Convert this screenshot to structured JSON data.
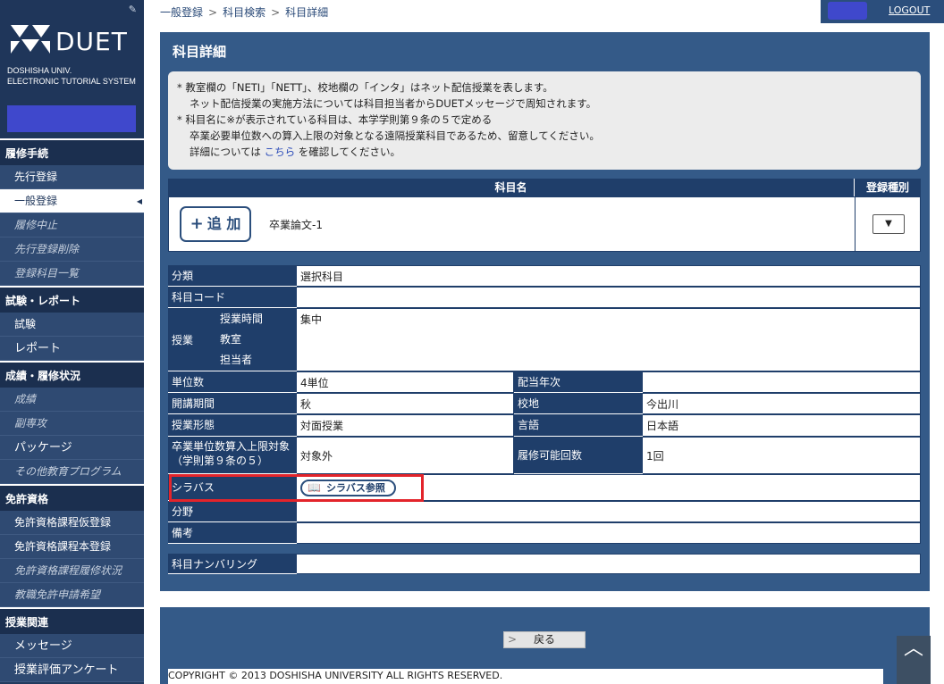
{
  "app": {
    "logo_text": "DUET",
    "logo_sub1": "DOSHISHA UNIV.",
    "logo_sub2": "ELECTRONIC TUTORIAL SYSTEM"
  },
  "sidebar": {
    "sections": [
      {
        "title": "履修手続",
        "items": [
          {
            "label": "先行登録",
            "style": "normal"
          },
          {
            "label": "一般登録",
            "style": "active"
          },
          {
            "label": "履修中止",
            "style": "italic"
          },
          {
            "label": "先行登録削除",
            "style": "italic"
          },
          {
            "label": "登録科目一覧",
            "style": "italic"
          }
        ]
      },
      {
        "title": "試験・レポート",
        "items": [
          {
            "label": "試験",
            "style": "normal"
          },
          {
            "label": "レポート",
            "style": "big"
          }
        ]
      },
      {
        "title": "成績・履修状況",
        "items": [
          {
            "label": "成績",
            "style": "italic"
          },
          {
            "label": "副専攻",
            "style": "italic"
          },
          {
            "label": "パッケージ",
            "style": "big"
          },
          {
            "label": "その他教育プログラム",
            "style": "italic"
          }
        ]
      },
      {
        "title": "免許資格",
        "items": [
          {
            "label": "免許資格課程仮登録",
            "style": "normal"
          },
          {
            "label": "免許資格課程本登録",
            "style": "normal"
          },
          {
            "label": "免許資格課程履修状況",
            "style": "italic"
          },
          {
            "label": "教職免許申請希望",
            "style": "italic"
          }
        ]
      },
      {
        "title": "授業関連",
        "items": [
          {
            "label": "メッセージ",
            "style": "big"
          },
          {
            "label": "授業評価アンケート",
            "style": "big"
          }
        ]
      }
    ]
  },
  "breadcrumb": [
    "一般登録",
    "科目検索",
    "科目詳細"
  ],
  "header": {
    "logout": "LOGOUT"
  },
  "panel": {
    "title": "科目詳細",
    "notice": {
      "line1": "* 教室欄の「NETI」「NETT」、校地欄の「インタ」はネット配信授業を表します。",
      "line2": "ネット配信授業の実施方法については科目担当者からDUETメッセージで周知されます。",
      "line3": "* 科目名に※が表示されている科目は、本学学則第９条の５で定める",
      "line4": "卒業必要単位数への算入上限の対象となる遠隔授業科目であるため、留意してください。",
      "line5_pre": "詳細については",
      "line5_link": "こちら",
      "line5_post": "を確認してください。"
    },
    "course_header": {
      "name_col": "科目名",
      "type_col": "登録種別",
      "add_label": "追 加",
      "course_name": "卒業論文-1",
      "select_value": ""
    },
    "details": {
      "category_label": "分類",
      "category_value": "選択科目",
      "code_label": "科目コード",
      "code_value": "",
      "class_label": "授業",
      "time_label": "授業時間",
      "time_value": "集中",
      "room_label": "教室",
      "room_value": "",
      "teacher_label": "担当者",
      "teacher_value": "",
      "credits_label": "単位数",
      "credits_value": "4単位",
      "year_label": "配当年次",
      "year_value": "",
      "term_label": "開講期間",
      "term_value": "秋",
      "campus_label": "校地",
      "campus_value": "今出川",
      "format_label": "授業形態",
      "format_value": "対面授業",
      "language_label": "言語",
      "language_value": "日本語",
      "limit_label1": "卒業単位数算入上限対象",
      "limit_label2": "（学則第９条の５）",
      "limit_value": "対象外",
      "repeat_label": "履修可能回数",
      "repeat_value": "1回",
      "syllabus_label": "シラバス",
      "syllabus_button": "シラバス参照",
      "field_label": "分野",
      "field_value": "",
      "notes_label": "備考",
      "notes_value": "",
      "numbering_label": "科目ナンバリング",
      "numbering_value": ""
    }
  },
  "footer": {
    "back": "戻る",
    "copyright": "COPYRIGHT © 2013 DOSHISHA UNIVERSITY ALL RIGHTS RESERVED."
  }
}
